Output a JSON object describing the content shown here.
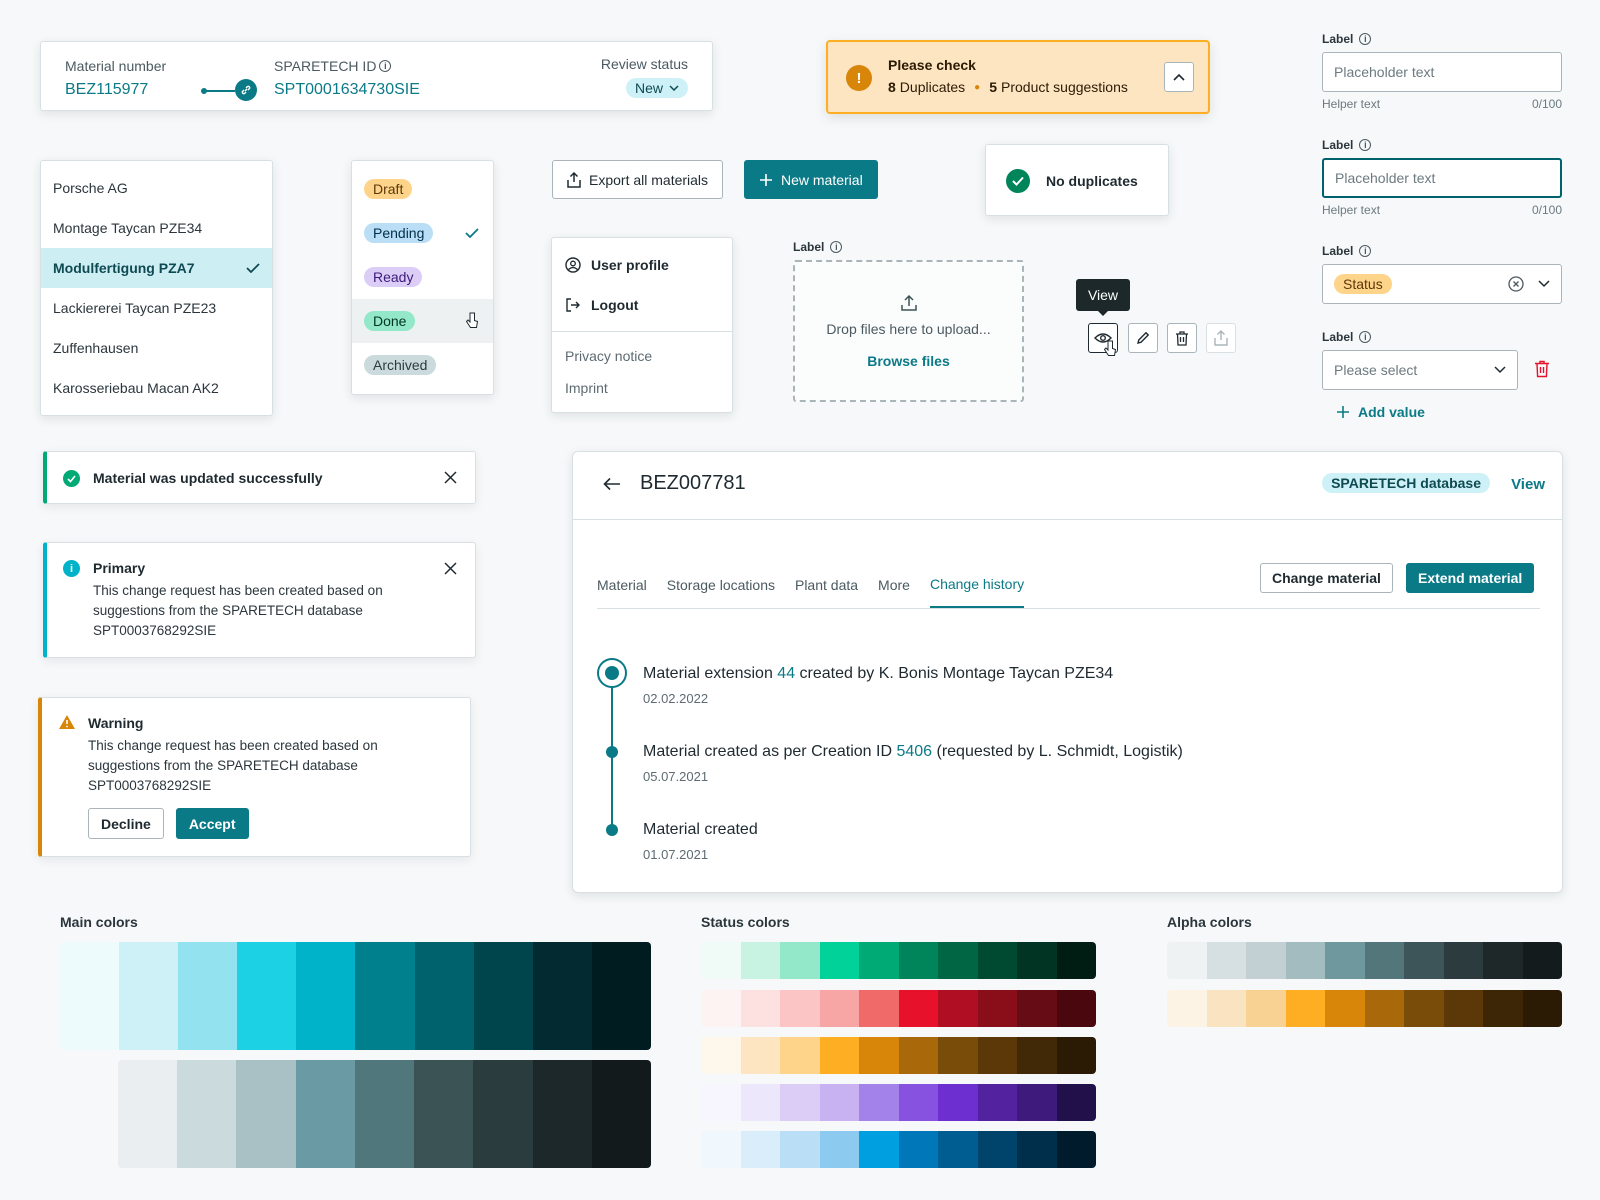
{
  "material_header": {
    "material_number_label": "Material number",
    "material_number": "BEZ115977",
    "sparetech_label": "SPARETECH ID",
    "sparetech_id": "SPT0001634730SIE",
    "review_label": "Review status",
    "review_value": "New"
  },
  "check_banner": {
    "title": "Please check",
    "dup_count": "8",
    "dup_label": "Duplicates",
    "sugg_count": "5",
    "sugg_label": "Product suggestions"
  },
  "no_duplicates": "No duplicates",
  "plant_list": {
    "items": [
      "Porsche AG",
      "Montage Taycan PZE34",
      "Modulfertigung PZA7",
      "Lackiererei Taycan PZE23",
      "Zuffenhausen",
      "Karosseriebau Macan AK2"
    ]
  },
  "status_list": {
    "items": [
      "Draft",
      "Pending",
      "Ready",
      "Done",
      "Archived"
    ]
  },
  "toolbar": {
    "export_label": "Export all materials",
    "new_label": "New material"
  },
  "user_menu": {
    "profile": "User profile",
    "logout": "Logout",
    "privacy": "Privacy notice",
    "imprint": "Imprint"
  },
  "upload": {
    "label": "Label",
    "drop_text": "Drop files here to upload...",
    "browse": "Browse files"
  },
  "tooltip": "View",
  "form": {
    "field1": {
      "label": "Label",
      "placeholder": "Placeholder text",
      "helper": "Helper text",
      "count": "0/100"
    },
    "field2": {
      "label": "Label",
      "placeholder": "Placeholder text",
      "helper": "Helper text",
      "count": "0/100"
    },
    "field3": {
      "label": "Label",
      "value": "Status"
    },
    "field4": {
      "label": "Label",
      "placeholder": "Please select"
    },
    "add_value": "Add value"
  },
  "alerts": {
    "success": "Material was updated successfully",
    "primary_title": "Primary",
    "primary_body": "This change request has been created based on suggestions from the SPARETECH database SPT0003768292SIE",
    "warning_title": "Warning",
    "warning_body": "This change request has been created based on suggestions from the SPARETECH database SPT0003768292SIE",
    "decline": "Decline",
    "accept": "Accept"
  },
  "detail": {
    "title": "BEZ007781",
    "db_badge": "SPARETECH database",
    "view_link": "View",
    "tabs": [
      "Material",
      "Storage locations",
      "Plant data",
      "More",
      "Change history"
    ],
    "change_btn": "Change material",
    "extend_btn": "Extend material",
    "timeline": [
      {
        "pre": "Material extension ",
        "link": "44",
        "post": " created by K. Bonis Montage Taycan PZE34",
        "date": "02.02.2022"
      },
      {
        "pre": "Material created as per Creation ID ",
        "link": "5406",
        "post": " (requested by L. Schmidt, Logistik)",
        "date": "05.07.2021"
      },
      {
        "pre": "Material created",
        "link": "",
        "post": "",
        "date": "01.07.2021"
      }
    ]
  },
  "colors": {
    "main_title": "Main colors",
    "status_title": "Status colors",
    "alpha_title": "Alpha colors",
    "accent": "#0b7a87",
    "main_teal": [
      "#eefbfc",
      "#cdf1f6",
      "#92e3ef",
      "#1bd1e3",
      "#00b3c8",
      "#007f8c",
      "#00626d",
      "#00444c",
      "#022a30",
      "#011c20"
    ],
    "main_grey": [
      "#eaeef0",
      "#cbdadd",
      "#a9c0c4",
      "#6a9aa3",
      "#50777c",
      "#3c5356",
      "#2b3c3f",
      "#1c2829",
      "#121a1c"
    ],
    "status_green": [
      "#f0faf6",
      "#c8f3e3",
      "#92e8c9",
      "#00d29a",
      "#00aa74",
      "#00855b",
      "#006643",
      "#004a31",
      "#013423",
      "#001d13"
    ],
    "status_red": [
      "#fdf3f3",
      "#fde0e0",
      "#fcc5c5",
      "#f8a5a5",
      "#f06a6a",
      "#e8112b",
      "#b00f23",
      "#8a0e1a",
      "#660c14",
      "#4a080e"
    ],
    "status_orange": [
      "#fef8ec",
      "#fde5c1",
      "#fed48b",
      "#fdae22",
      "#d8860a",
      "#a9680a",
      "#7a4c0a",
      "#5c3809",
      "#412807",
      "#2b1a04"
    ],
    "status_purple": [
      "#f7f5fd",
      "#ede7fb",
      "#dbcdf6",
      "#c8b2f2",
      "#a382e9",
      "#8752df",
      "#6d2fd0",
      "#52229f",
      "#3d1a7b",
      "#22104a"
    ],
    "status_blue": [
      "#f1f8fd",
      "#daedfa",
      "#b9def5",
      "#8ccaf0",
      "#009fdf",
      "#0077b8",
      "#005d91",
      "#00446b",
      "#002f4b",
      "#001b2c"
    ],
    "alpha_teal": [
      "#eef2f3",
      "#d6dfe1",
      "#c2d0d3",
      "#a3bcc0",
      "#6f989e",
      "#53767b",
      "#3d5558",
      "#2c3b3d",
      "#1e2829",
      "#141b1c"
    ],
    "alpha_orange": [
      "#fcf3e4",
      "#f9e3c0",
      "#f8d293",
      "#fdae22",
      "#d8860a",
      "#a9680a",
      "#7a4c0a",
      "#5c3809",
      "#3d2606",
      "#2b1a04"
    ]
  }
}
